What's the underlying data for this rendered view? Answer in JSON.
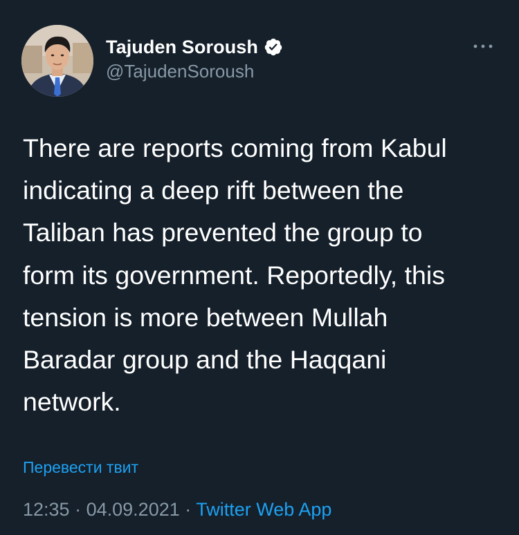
{
  "tweet": {
    "author": {
      "display_name": "Tajuden Soroush",
      "handle": "@TajudenSoroush",
      "verified": true,
      "verified_icon": "verified-badge-icon"
    },
    "more_icon": "more-options-icon",
    "text_lines": [
      "There are reports coming from Kabul",
      "indicating a deep rift between the",
      "Taliban has prevented the group to",
      "form its government. Reportedly, this",
      "tension is more between Mullah",
      "Baradar group and the Haqqani",
      "network."
    ],
    "translate_label": "Перевести твит",
    "time": "12:35",
    "separator": "·",
    "date": "04.09.2021",
    "source": "Twitter Web App"
  },
  "colors": {
    "background": "#15202b",
    "text": "#ffffff",
    "secondary": "#8899a6",
    "accent": "#1da1f2"
  }
}
